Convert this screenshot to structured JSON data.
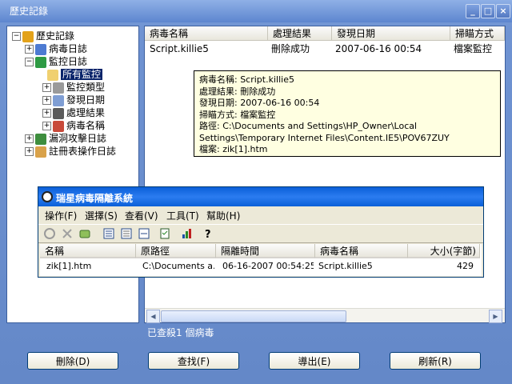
{
  "window": {
    "title": "歷史記錄",
    "min": "_",
    "max": "□",
    "close": "×"
  },
  "tree": {
    "root": "歷史記錄",
    "virus_log": "病毒日誌",
    "monitor_log": "監控日誌",
    "all_monitor": "所有監控",
    "monitor_type": "監控類型",
    "found_date": "發現日期",
    "result": "處理結果",
    "virus_name": "病毒名稱",
    "exploit_log": "漏洞攻擊日誌",
    "registry_log": "註冊表操作日誌"
  },
  "list": {
    "headers": [
      "病毒名稱",
      "處理結果",
      "發現日期",
      "掃瞄方式"
    ],
    "rows": [
      [
        "Script.killie5",
        "刪除成功",
        "2007-06-16 00:54",
        "檔案監控"
      ]
    ]
  },
  "tooltip": {
    "l1": "病毒名稱: Script.killie5",
    "l2": "處理結果: 刪除成功",
    "l3": "發現日期: 2007-06-16 00:54",
    "l4": "掃瞄方式: 檔案監控",
    "l5": "路徑: C:\\Documents and Settings\\HP_Owner\\Local Settings\\Temporary Internet Files\\Content.IE5\\POV67ZUY",
    "l6": "檔案: zik[1].htm"
  },
  "quarantine": {
    "title": "瑞星病毒隔離系統",
    "menu": [
      "操作(F)",
      "選擇(S)",
      "查看(V)",
      "工具(T)",
      "幫助(H)"
    ],
    "headers": [
      "名稱",
      "原路徑",
      "隔離時間",
      "病毒名稱",
      "大小(字節)"
    ],
    "row": [
      "zik[1].htm",
      "C:\\Documents a...",
      "06-16-2007 00:54:25",
      "Script.killie5",
      "429"
    ]
  },
  "status": "已查殺1 個病毒",
  "buttons": {
    "delete": "刪除(D)",
    "find": "查找(F)",
    "export": "導出(E)",
    "refresh": "刷新(R)"
  },
  "colors": {
    "title_bar": "#5d86cf",
    "selection": "#0a246a",
    "tooltip_bg": "#ffffe1",
    "quarantine_title": "#0a5fd8"
  }
}
